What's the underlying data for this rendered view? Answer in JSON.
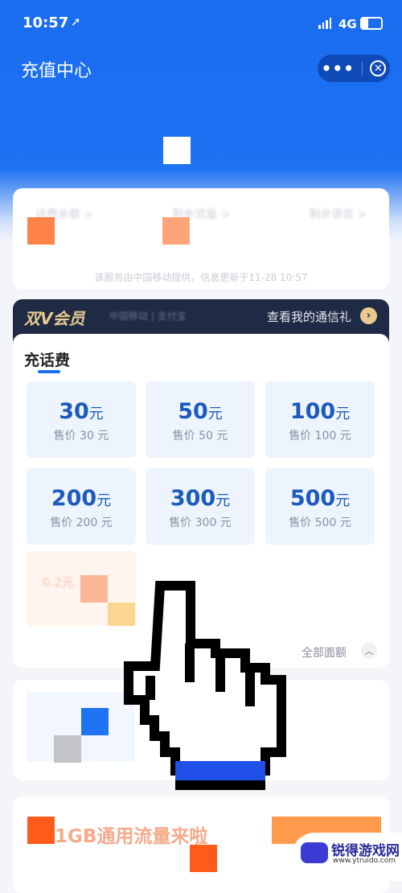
{
  "status_bar": {
    "time": "10:57",
    "network": "4G",
    "icons": [
      "location-arrow-icon",
      "signal-icon",
      "battery-icon"
    ]
  },
  "header": {
    "title": "充值中心",
    "more_icon": "more-icon",
    "close_icon": "close-circle-icon"
  },
  "balance_card": {
    "labels": [
      "话费余额 >",
      "剩余流量 >",
      "剩余语音 >"
    ],
    "footer": "该服务由中国移动提供，信息更新于11-28 10:57"
  },
  "vip_banner": {
    "title": "双V会员",
    "partners": "中国移动 | 支付宝",
    "link": "查看我的通信礼"
  },
  "recharge": {
    "tab": "充话费",
    "unit": "元",
    "tiles": [
      {
        "amount": "30",
        "price": "售价 30 元"
      },
      {
        "amount": "50",
        "price": "售价 50 元"
      },
      {
        "amount": "100",
        "price": "售价 100 元"
      },
      {
        "amount": "200",
        "price": "售价 200 元"
      },
      {
        "amount": "300",
        "price": "售价 300 元"
      },
      {
        "amount": "500",
        "price": "售价 500 元"
      }
    ],
    "promo": "0.2元",
    "all_amounts": "全部面额"
  },
  "promo_card": {
    "title": "1GB通用流量来啦"
  },
  "watermark": {
    "name": "锐得游戏网",
    "url": "www.ytruido.com"
  },
  "colors": {
    "brand_blue": "#1a6cf0",
    "amount_blue": "#1c5bbd",
    "vip_navy": "#1f2a44",
    "vip_gold": "#e8c98f",
    "cursor_blue": "#2050e8"
  }
}
